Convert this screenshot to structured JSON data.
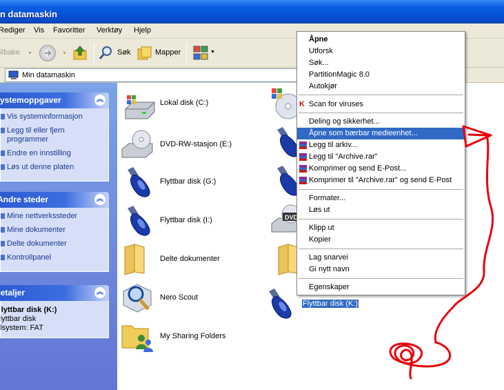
{
  "window": {
    "title": "n datamaskin"
  },
  "menu": {
    "items": [
      "Rediger",
      "Vis",
      "Favoritter",
      "Verktøy",
      "Hjelp"
    ]
  },
  "toolbar": {
    "back_label": "Tilbake",
    "search_label": "Søk",
    "folders_label": "Mapper"
  },
  "address": {
    "value": "Min datamaskin"
  },
  "tasks_panel": {
    "title": "Systemoppgaver",
    "items": [
      "Vis systeminformasjon",
      "Legg til eller fjern programmer",
      "Endre en innstilling",
      "Løs ut denne platen"
    ]
  },
  "places_panel": {
    "title": "Andre steder",
    "items": [
      "Mine nettverkssteder",
      "Mine dokumenter",
      "Delte dokumenter",
      "Kontrollpanel"
    ]
  },
  "details_panel": {
    "title": "Detaljer",
    "name": "Flyttbar disk (K:)",
    "type": "Flyttbar disk",
    "filesystem": "Filsystem: FAT"
  },
  "drives": {
    "c": "Lokal disk (C:)",
    "e": "DVD-RW-stasjon (E:)",
    "g": "Flyttbar disk (G:)",
    "i": "Flyttbar disk (I:)",
    "shared": "Delte dokumenter",
    "nero": "Nero Scout",
    "sharing": "My Sharing Folders",
    "k": "Flyttbar disk (K:)",
    "dvd_badge": "DVD"
  },
  "context_menu": {
    "open": "Åpne",
    "explore": "Utforsk",
    "search": "Søk...",
    "partitionmagic": "PartitionMagic 8.0",
    "autoplay": "Autokjør",
    "scan": "Scan for viruses",
    "sharing": "Deling og sikkerhet...",
    "open_portable": "Åpne som bærbar medieenhet...",
    "add_archive": "Legg til arkiv...",
    "add_rar": "Legg til \"Archive.rar\"",
    "compress_email": "Komprimer og send E-Post...",
    "compress_rar_email": "Komprimer til \"Archive.rar\" og send E-Post",
    "format": "Formater...",
    "eject": "Løs ut",
    "cut": "Klipp ut",
    "copy": "Kopier",
    "shortcut": "Lag snarvei",
    "rename": "Gi nytt navn",
    "properties": "Egenskaper"
  },
  "colors": {
    "xp_blue": "#0550d4",
    "highlight": "#316ac5",
    "ink": "#e8000b"
  }
}
